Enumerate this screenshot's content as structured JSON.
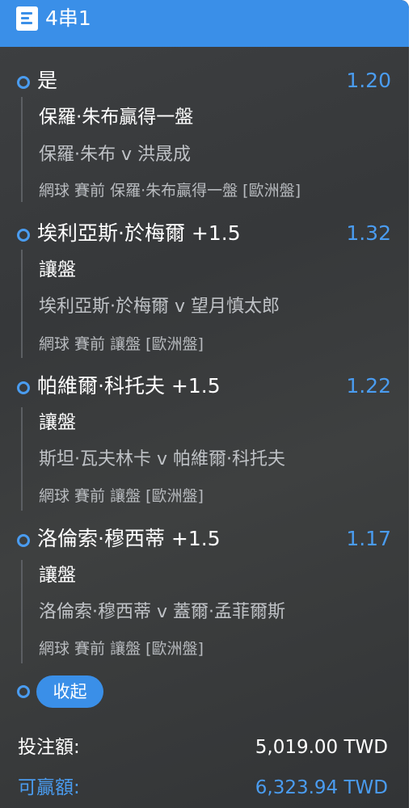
{
  "header": {
    "title": "4串1",
    "icon": "betslip-icon"
  },
  "colors": {
    "accent": "#3a8fe8",
    "odds": "#4a9cf0",
    "background": "#38393b"
  },
  "legs": [
    {
      "selection": "是",
      "odds": "1.20",
      "market": "保羅·朱布贏得一盤",
      "match": "保羅·朱布 v 洪晟成",
      "meta": "網球 賽前  保羅·朱布贏得一盤 [歐洲盤]"
    },
    {
      "selection": "埃利亞斯·於梅爾 +1.5",
      "odds": "1.32",
      "market": "讓盤",
      "match": "埃利亞斯·於梅爾 v 望月慎太郎",
      "meta": "網球 賽前  讓盤 [歐洲盤]"
    },
    {
      "selection": "帕維爾·科托夫 +1.5",
      "odds": "1.22",
      "market": "讓盤",
      "match": "斯坦·瓦夫林卡 v 帕維爾·科托夫",
      "meta": "網球 賽前  讓盤 [歐洲盤]"
    },
    {
      "selection": "洛倫索·穆西蒂 +1.5",
      "odds": "1.17",
      "market": "讓盤",
      "match": "洛倫索·穆西蒂 v 蓋爾·孟菲爾斯",
      "meta": "網球 賽前  讓盤 [歐洲盤]"
    }
  ],
  "collapse_label": "收起",
  "summary": {
    "stake_label": "投注額:",
    "stake_value": "5,019.00 TWD",
    "win_label": "可贏額:",
    "win_value": "6,323.94 TWD"
  }
}
